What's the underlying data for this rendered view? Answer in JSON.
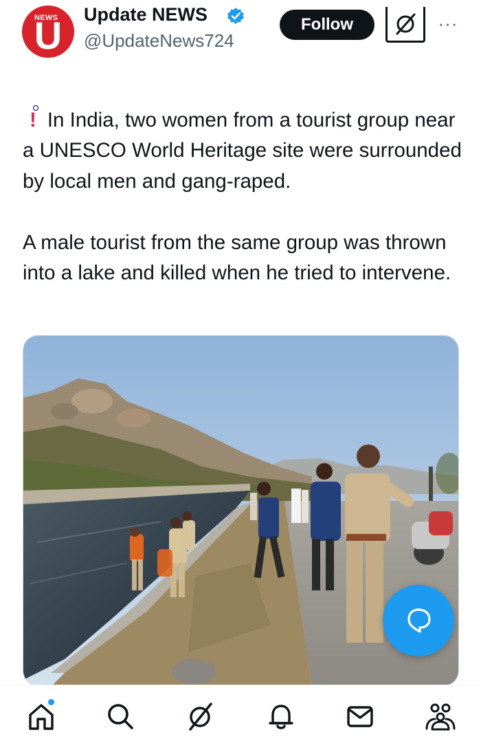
{
  "header": {
    "display_name": "Update NEWS",
    "handle": "@UpdateNews724",
    "avatar_label": "NEWS",
    "avatar_letter": "U",
    "follow_label": "Follow",
    "more_label": "···",
    "verified": true
  },
  "tweet": {
    "paragraph1": "In India, two women from a tourist group near a UNESCO World Heritage site were surrounded by local men and gang-raped.",
    "paragraph2": "A male tourist from the same group was thrown into a lake and killed when he tried to intervene.",
    "leading_icons": [
      "india-flag-icon",
      "exclamation-icon"
    ]
  },
  "media": {
    "description_icon": "photo-canal-rocky-hills-police"
  },
  "bottom_nav": {
    "items": [
      "home-icon",
      "search-icon",
      "grok-icon",
      "notifications-icon",
      "messages-icon",
      "communities-icon"
    ]
  },
  "colors": {
    "accent": "#1d9bf0",
    "text": "#0f1419",
    "secondary_text": "#536471",
    "brand_red": "#d8232a"
  }
}
